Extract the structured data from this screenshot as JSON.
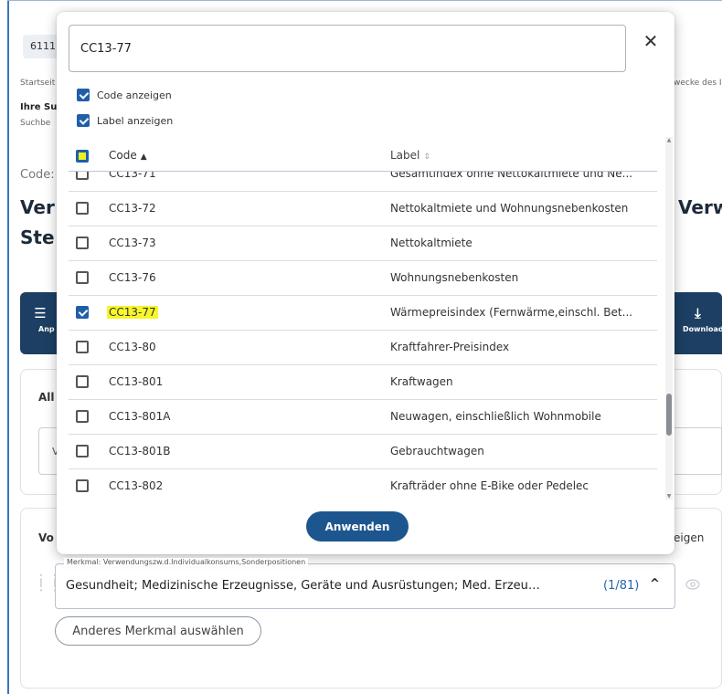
{
  "background": {
    "code_chip": "6111",
    "breadcrumb": "Startseit",
    "breadcrumb_right": "wecke des I",
    "your_search": "Ihre Su",
    "search_term": "Suchbe",
    "code_label": "Code:",
    "title_line1_left": "Ver",
    "title_line1_right": "Verw",
    "title_line2_left": "Ste",
    "toolbar_left_label": "Anp",
    "toolbar_right_label": "Download",
    "panel_label": "All",
    "panel_field_value": "V",
    "section_label": "Vo",
    "section_right": "eigen",
    "merkmal_legend": "Merkmal: Verwendungszw.d.Individualkonsums,Sonderpositionen",
    "merkmal_value": "Gesundheit; Medizinische Erzeugnisse, Geräte und Ausrüstungen; Med. Erzeugnisse, Gerä...",
    "merkmal_count": "(1/81)",
    "other_merkmal_button": "Anderes Merkmal auswählen"
  },
  "modal": {
    "search_value": "CC13-77",
    "close_icon": "close-icon",
    "option_show_code": "Code anzeigen",
    "option_show_label": "Label anzeigen",
    "show_code_checked": true,
    "show_label_checked": true,
    "column_code": "Code",
    "column_label": "Label",
    "rows": [
      {
        "code": "CC13-71",
        "label": "Gesamtindex ohne Nettokaltmiete und Ne...",
        "checked": false
      },
      {
        "code": "CC13-72",
        "label": "Nettokaltmiete und Wohnungsnebenkosten",
        "checked": false
      },
      {
        "code": "CC13-73",
        "label": "Nettokaltmiete",
        "checked": false
      },
      {
        "code": "CC13-76",
        "label": "Wohnungsnebenkosten",
        "checked": false
      },
      {
        "code": "CC13-77",
        "label": "Wärmepreisindex (Fernwärme,einschl. Bet...",
        "checked": true
      },
      {
        "code": "CC13-80",
        "label": "Kraftfahrer-Preisindex",
        "checked": false
      },
      {
        "code": "CC13-801",
        "label": "Kraftwagen",
        "checked": false
      },
      {
        "code": "CC13-801A",
        "label": "Neuwagen, einschließlich Wohnmobile",
        "checked": false
      },
      {
        "code": "CC13-801B",
        "label": "Gebrauchtwagen",
        "checked": false
      },
      {
        "code": "CC13-802",
        "label": "Krafträder ohne E-Bike oder Pedelec",
        "checked": false
      }
    ],
    "apply_button": "Anwenden"
  }
}
